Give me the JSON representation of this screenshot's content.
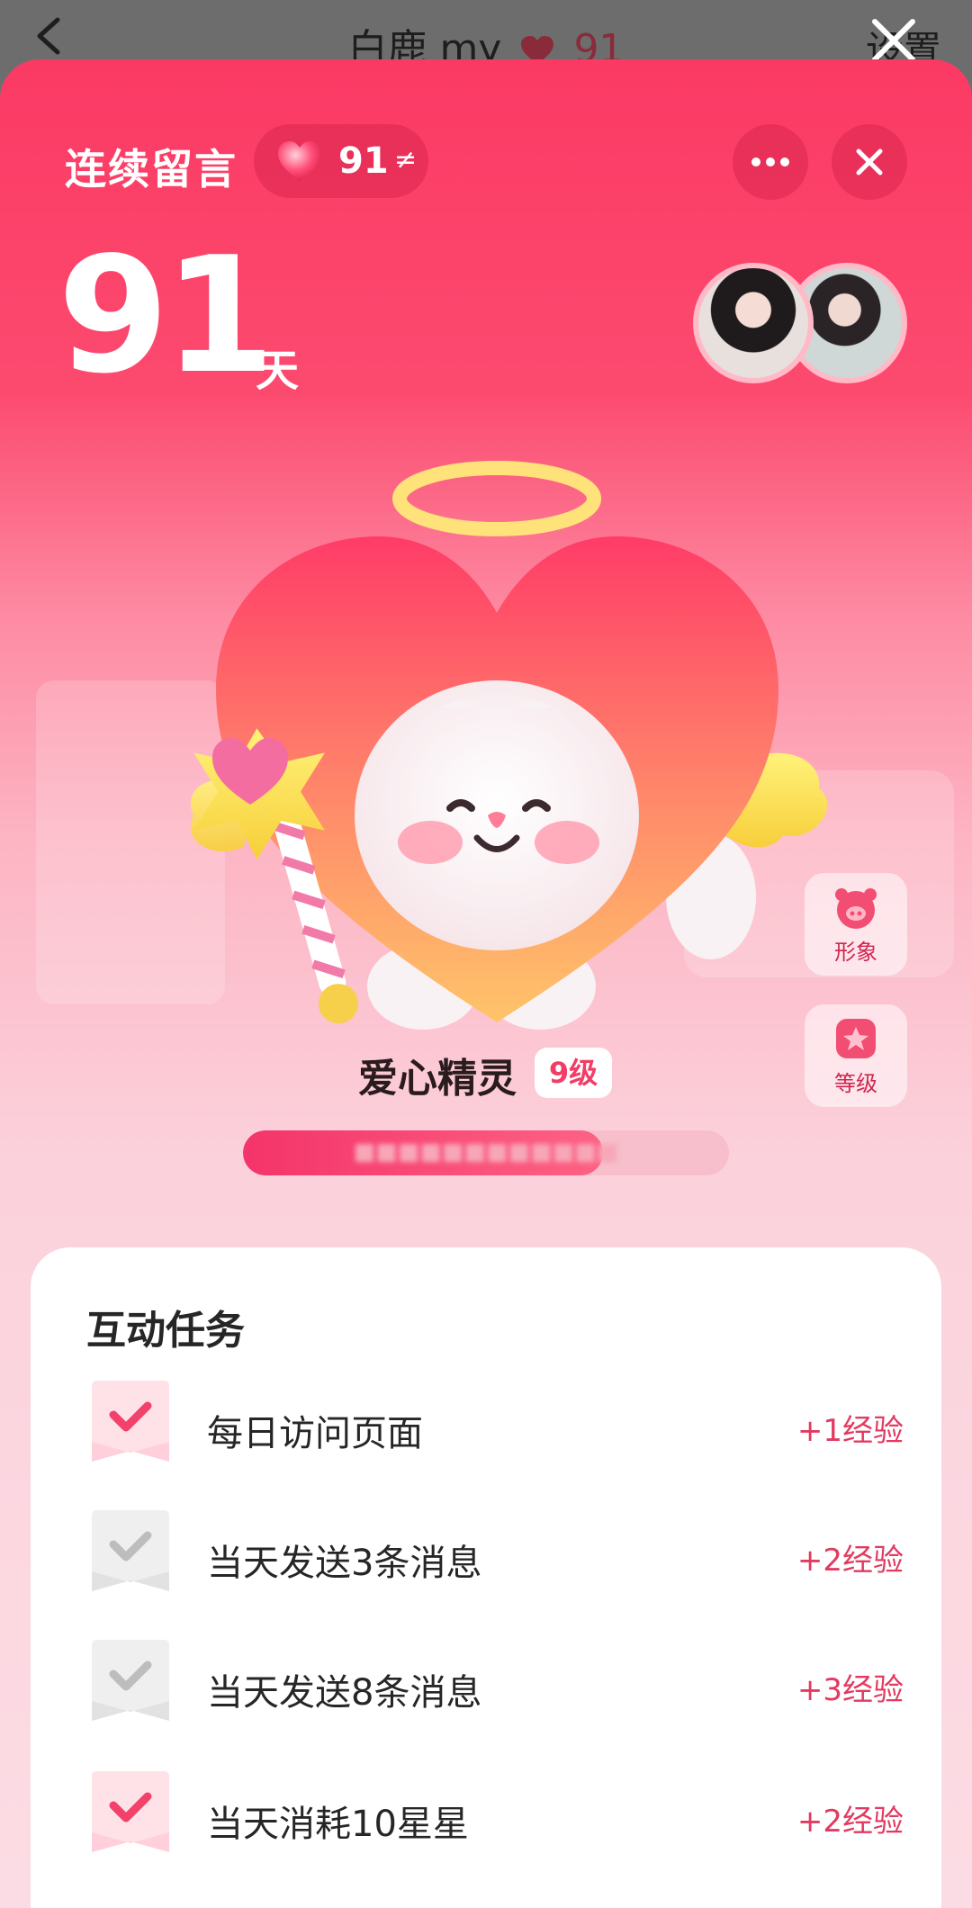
{
  "background_page": {
    "title": "白鹿 my",
    "count": "91",
    "settings_label": "设置"
  },
  "header": {
    "title": "连续留言",
    "streak_badge_value": "91"
  },
  "streak": {
    "days": "91",
    "unit": "天"
  },
  "side_buttons": {
    "appearance_label": "形象",
    "level_label": "等级"
  },
  "sprite": {
    "name": "爱心精灵",
    "level": "9级",
    "progress_fraction": 0.74
  },
  "tasks_card": {
    "title": "互动任务",
    "tasks": [
      {
        "label": "每日访问页面",
        "reward": "+1经验",
        "done": true
      },
      {
        "label": "当天发送3条消息",
        "reward": "+2经验",
        "done": false
      },
      {
        "label": "当天发送8条消息",
        "reward": "+3经验",
        "done": false
      },
      {
        "label": "当天消耗10星星",
        "reward": "+2经验",
        "done": true
      }
    ]
  },
  "colors": {
    "accent": "#f23d66",
    "sheet_top": "#fb3a64",
    "reward_text": "#e23a60"
  }
}
